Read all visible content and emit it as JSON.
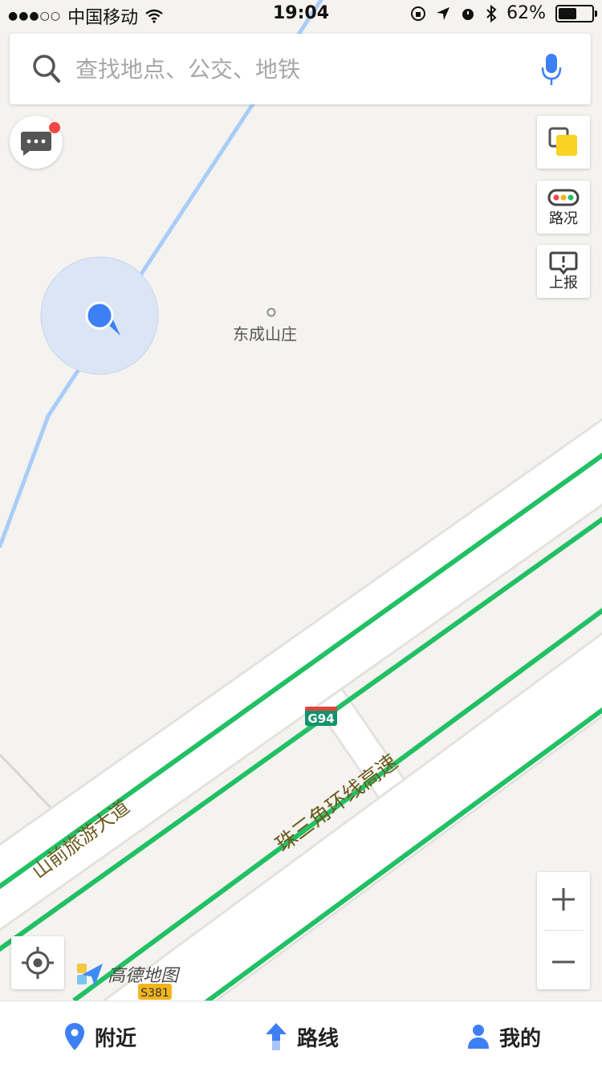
{
  "status_bar": {
    "carrier": "中国移动",
    "time": "19:04",
    "battery_percent": "62%",
    "battery_level": 0.62
  },
  "search": {
    "placeholder": "查找地点、公交、地铁"
  },
  "right_controls": {
    "traffic_label": "路况",
    "report_label": "上报"
  },
  "zoom": {
    "in_label": "+",
    "out_label": "−"
  },
  "map": {
    "poi_name": "东成山庄",
    "road_labels": {
      "travel_avenue": "山前旅游大道",
      "ring_expressway": "珠三角环线高速"
    },
    "highway_shields": {
      "g94": "G94",
      "s381": "S381"
    },
    "brand": "高德地图"
  },
  "tabs": [
    {
      "label": "附近",
      "icon": "location-pin-icon"
    },
    {
      "label": "路线",
      "icon": "route-arrow-icon"
    },
    {
      "label": "我的",
      "icon": "user-icon"
    }
  ],
  "colors": {
    "accent": "#3d7ff5",
    "road_green": "#22c064",
    "river": "#a9cdf8",
    "map_bg": "#f5f3ef"
  }
}
